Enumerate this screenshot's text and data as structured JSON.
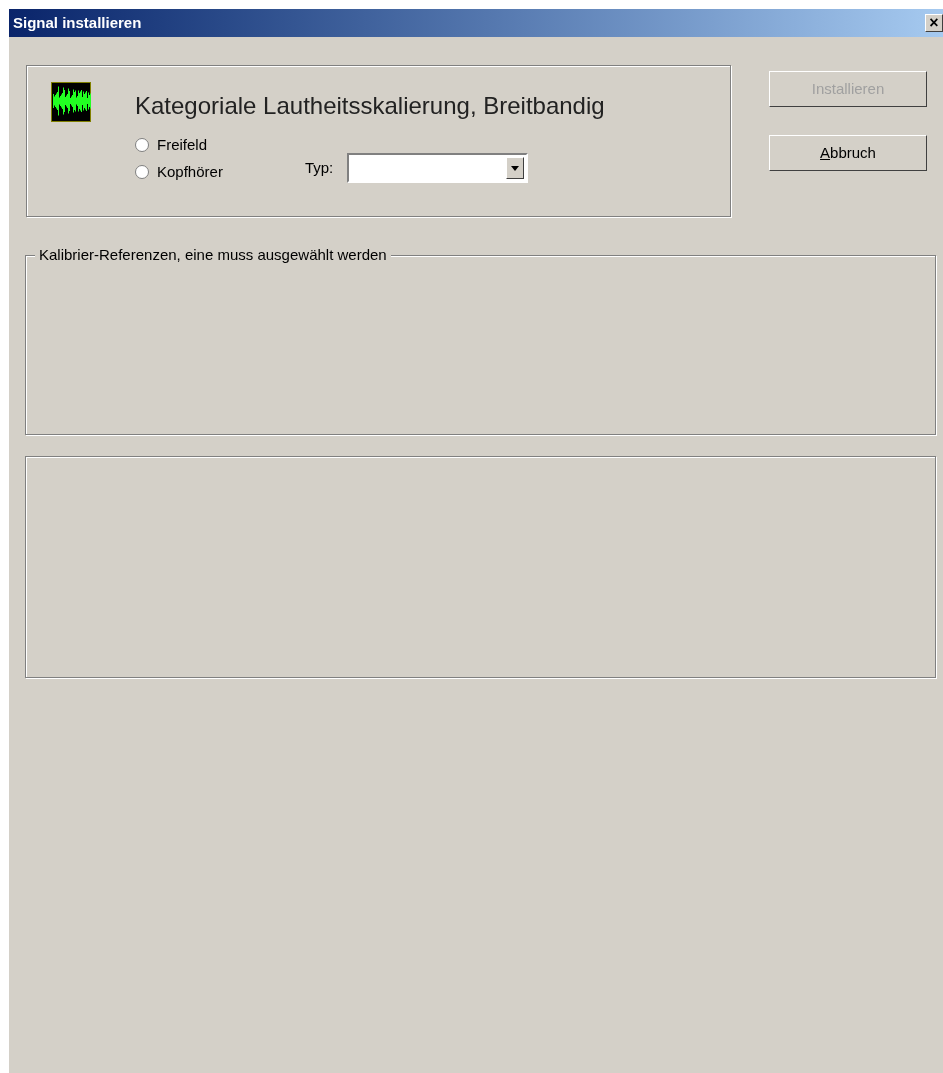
{
  "window": {
    "title": "Signal installieren",
    "close": "×"
  },
  "signal": {
    "title": "Kategoriale Lautheitsskalierung, Breitbandig",
    "modes": [
      {
        "label": "Freifeld",
        "selected": false
      },
      {
        "label": "Kopfhörer",
        "selected": false
      }
    ],
    "type_label": "Typ:"
  },
  "buttons": [
    {
      "label": "Installieren",
      "disabled": true
    },
    {
      "label": "Abbruch",
      "disabled": false
    }
  ],
  "calibration": {
    "title": "Kalibrier-Referenzen, eine muss ausgewählt werden"
  }
}
